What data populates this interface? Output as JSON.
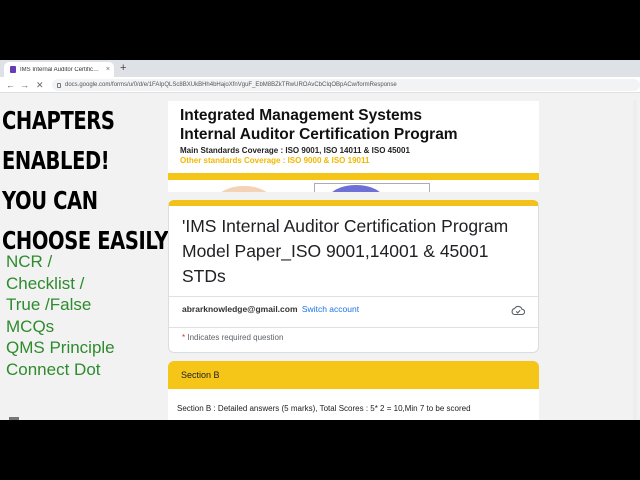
{
  "browser": {
    "tab_title": "IMS Internal Auditor Certificatio",
    "tab_close": "×",
    "new_tab": "+",
    "url": "docs.google.com/forms/u/0/d/e/1FAIpQLSc8BXUkBHh4bHajoXfnVguF_EbM8BZkTRwUROAvCbCIqOBpACw/formResponse",
    "back": "←",
    "forward": "→",
    "reload": "✕"
  },
  "overlay": {
    "headline_lines": [
      "CHAPTERS",
      "ENABLED!",
      "YOU CAN",
      "CHOOSE EASILY!"
    ],
    "topic_lines": [
      "NCR /",
      "Checklist /",
      "True /False",
      "MCQs",
      "QMS Principle",
      "Connect Dot"
    ]
  },
  "banner": {
    "line1": "Integrated Management Systems",
    "line2": "Internal Auditor Certification Program",
    "main_standards": "Main Standards Coverage : ISO 9001, ISO 14011 & ISO 45001",
    "other_standards": "Other standards Coverage : ISO 9000 & ISO 19011"
  },
  "form": {
    "title": "'IMS Internal Auditor Certification Program Model Paper_ISO 9001,14001 & 45001 STDs",
    "account_email": "abrarknowledge@gmail.com",
    "switch_account": "Switch account",
    "required_star": "* ",
    "required_text": "Indicates required question"
  },
  "section": {
    "header": "Section B",
    "description": "Section B : Detailed answers (5 marks), Total Scores :  5* 2 = 10,Min 7 to be scored"
  },
  "colors": {
    "accent_yellow": "#f5c518",
    "link_blue": "#1a73e8",
    "overlay_green": "#2e8b2e",
    "required_red": "#d93025"
  }
}
